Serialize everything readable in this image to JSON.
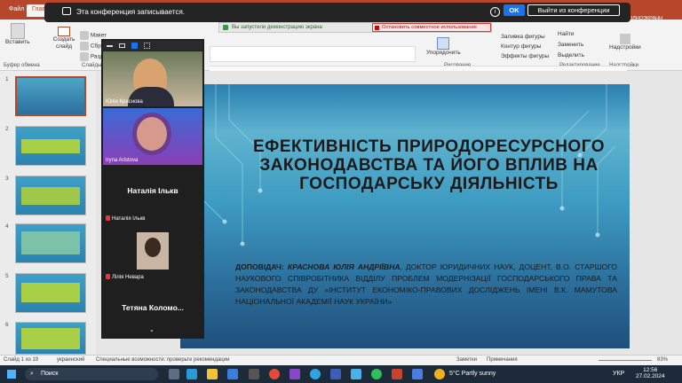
{
  "ribbon": {
    "tabs": [
      "Файл",
      "Глав"
    ],
    "buttons": {
      "paste": "Вставить",
      "create_slide": "Создать слайд",
      "layout": "Макет",
      "reset": "Сбросить",
      "section": "Раздел",
      "arrange": "Упорядочить",
      "find": "Найти",
      "replace": "Заменить",
      "select": "Выделить",
      "addins": "Надстройки",
      "fill": "Заливка фигуры",
      "outline": "Контур фигуры",
      "effects": "Эффекты фигуры",
      "fullscreen": "ПОЛНОЭКРАНН"
    },
    "groups": [
      "Буфер обмена",
      "Слайды",
      "Рисование",
      "Редактирование",
      "Надстройки"
    ]
  },
  "recording": {
    "text": "Эта конференция записывается.",
    "ok": "OK",
    "leave": "Выйти из конференции"
  },
  "sharing": {
    "status": "Вы запустили демонстрацию экрана",
    "stop": "Остановить совместное использование"
  },
  "participants": [
    {
      "name": "Юлія Краснова",
      "type": "video"
    },
    {
      "name": "Iryna Aristova",
      "type": "video"
    },
    {
      "name": "Наталія Ількв",
      "sub": "Наталія Ількв",
      "type": "name"
    },
    {
      "name": "Лілія Невара",
      "type": "photo"
    },
    {
      "name": "Тетяна Коломо..."
    }
  ],
  "slides": {
    "numbers": [
      "1",
      "2",
      "3",
      "4",
      "5",
      "6"
    ]
  },
  "main_slide": {
    "title": "ЕФЕКТИВНІСТЬ ПРИРОДОРЕСУРСНОГО ЗАКОНОДАВСТВА ТА ЙОГО ВПЛИВ НА ГОСПОДАРСЬКУ ДІЯЛЬНІСТЬ",
    "speaker_label": "ДОПОВІДАЧ:",
    "speaker_name": "КРАСНОВА ЮЛІЯ АНДРІЇВНА",
    "speaker_info": ", ДОКТОР ЮРИДИЧНИХ НАУК, ДОЦЕНТ, В.О. СТАРШОГО НАУКОВОГО СПІВРОБІТНИКА ВІДДІЛУ ПРОБЛЕМ МОДЕРНІЗАЦІЇ ГОСПОДАРСЬКОГО ПРАВА ТА ЗАКОНОДАВСТВА ДУ «ІНСТИТУТ ЕКОНОМІКО-ПРАВОВИХ ДОСЛІДЖЕНЬ ІМЕНІ В.К. МАМУТОВА НАЦІОНАЛЬНОЇ АКАДЕМІЇ НАУК УКРАЇНИ»"
  },
  "status": {
    "slide": "Слайд 1 из 19",
    "lang": "украинский",
    "access": "Специальные возможности: проверьте рекомендации",
    "notes": "Заметки",
    "comments": "Примечания",
    "zoom": "83%"
  },
  "taskbar": {
    "search": "Поиск",
    "weather": "5°C  Partly sunny",
    "lang": "УКР",
    "time": "12:56",
    "date": "27.02.2024"
  },
  "colors": {
    "accent": "#b7472a",
    "slide_bg": "#3d9bc1",
    "zoom_bg": "#1f1f1f"
  }
}
